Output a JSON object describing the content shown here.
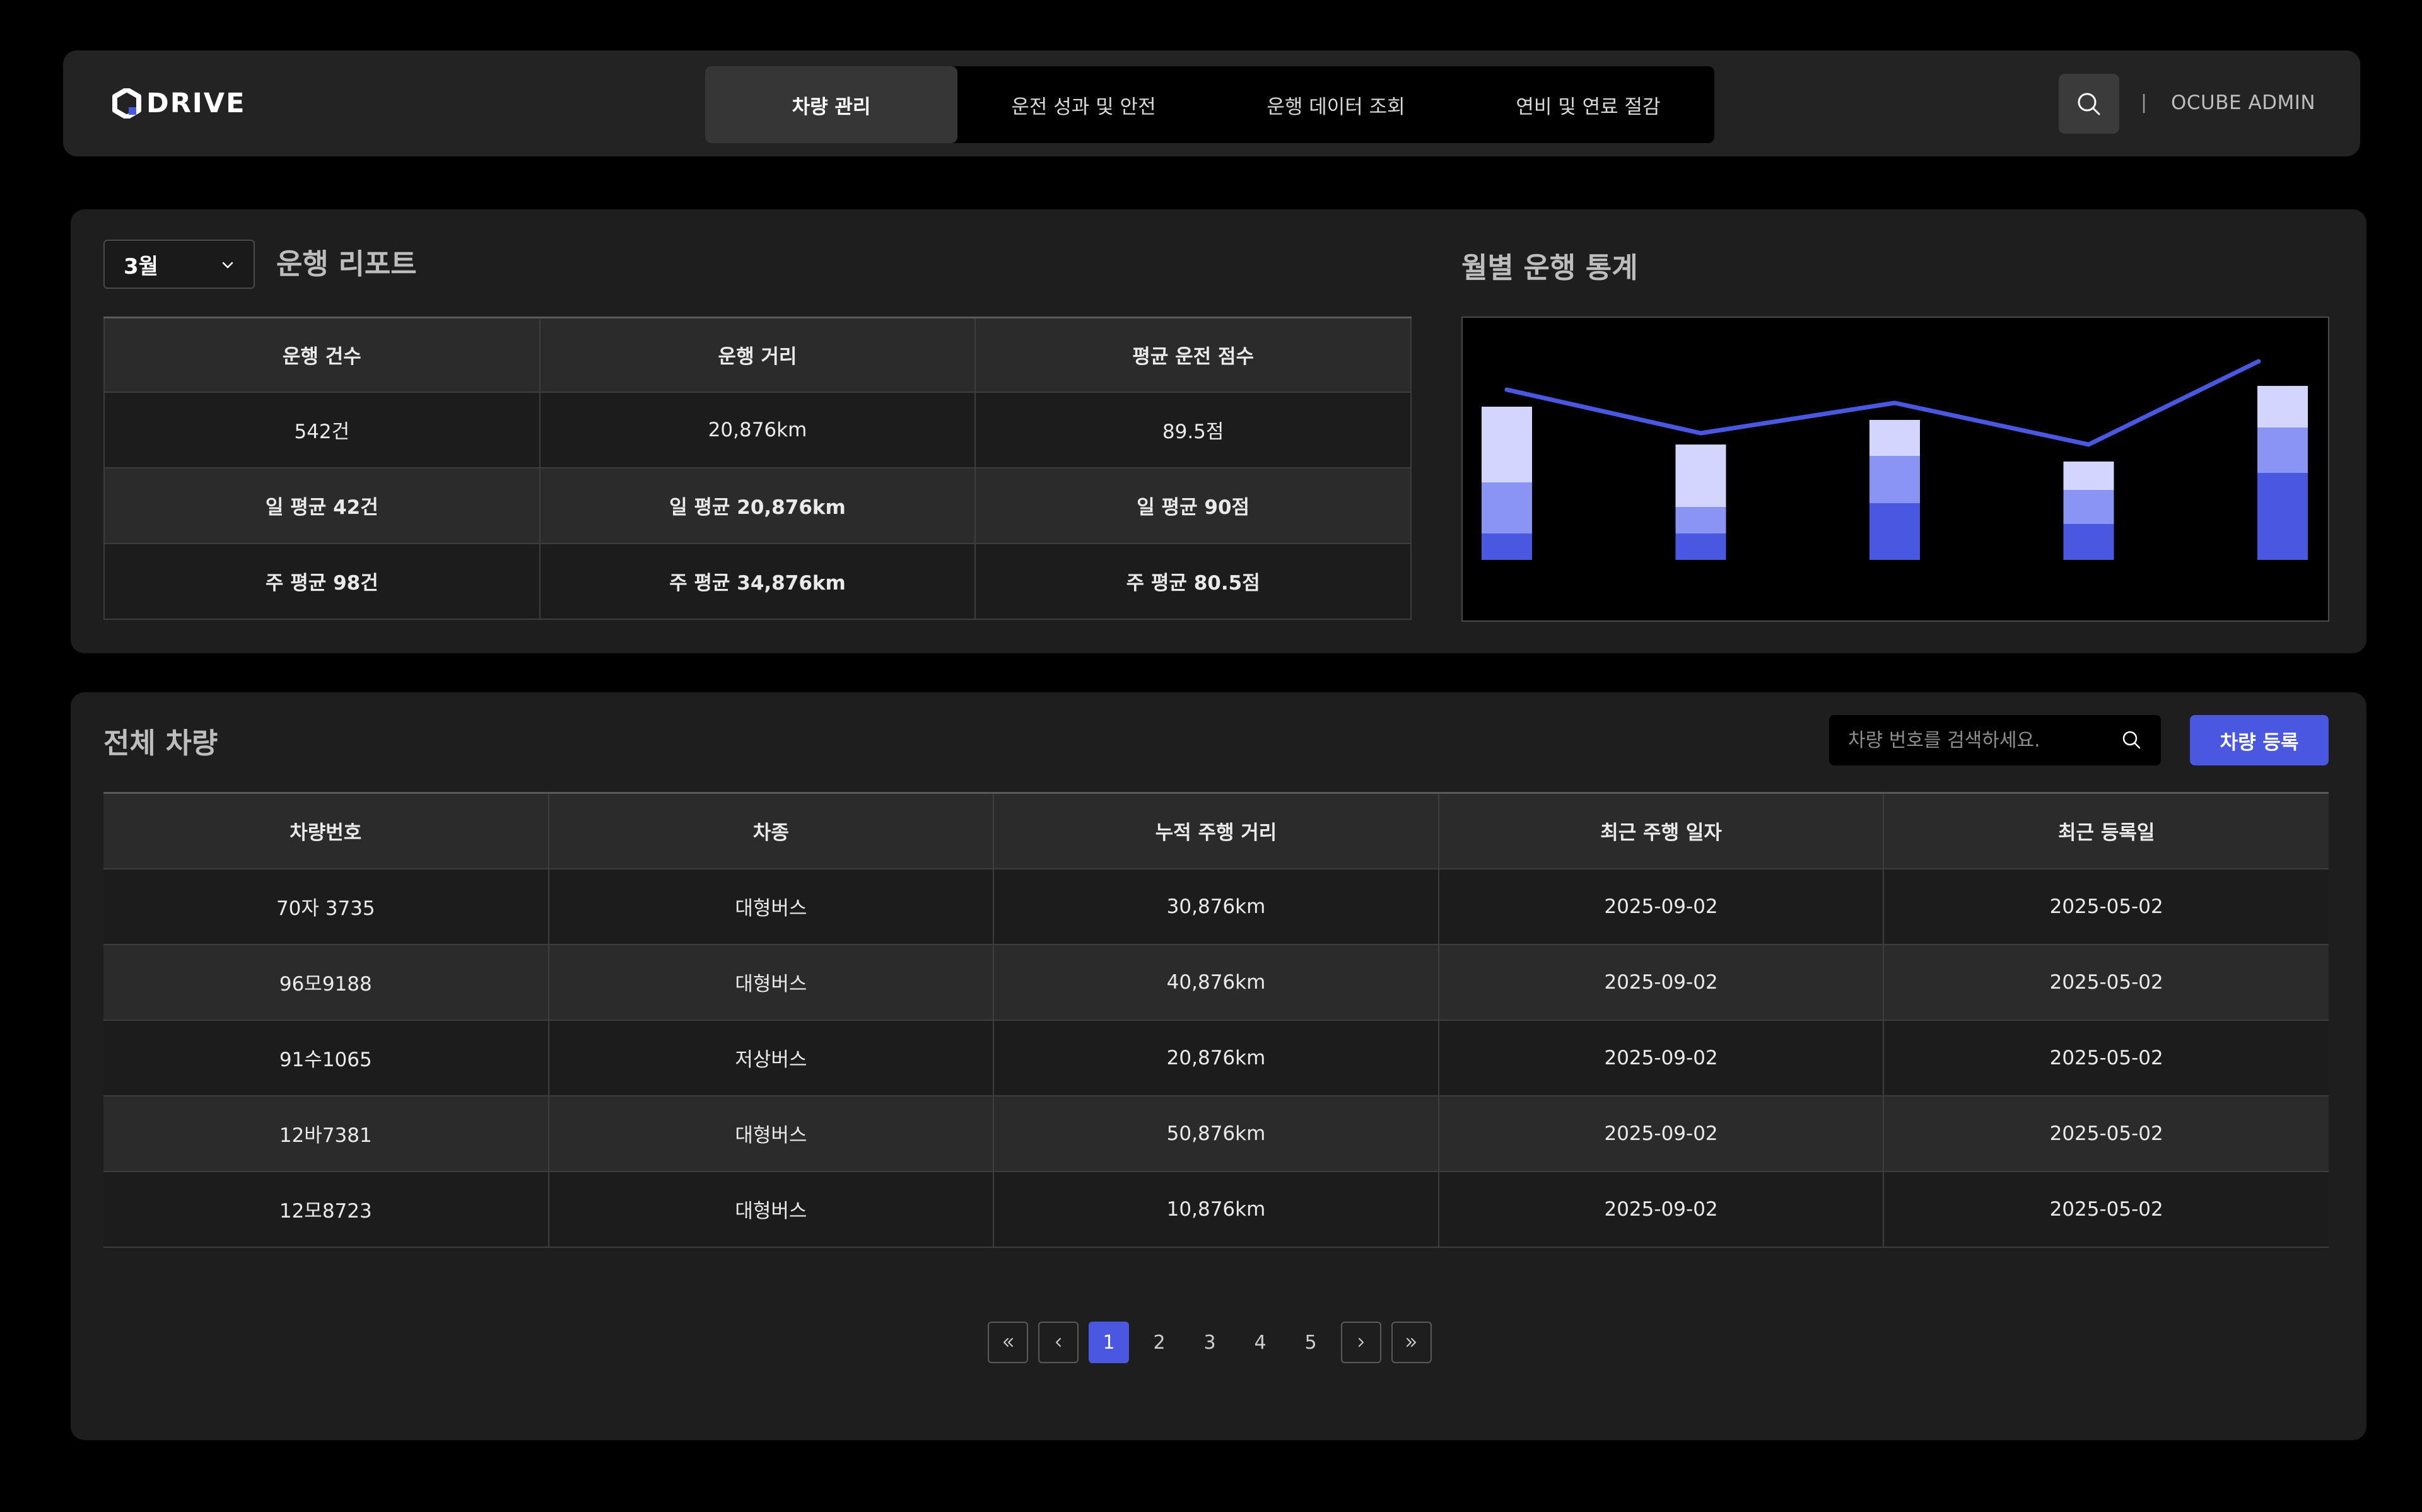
{
  "header": {
    "logo_text": "DRIVE",
    "nav_tabs": [
      {
        "label": "차량 관리",
        "active": true
      },
      {
        "label": "운전 성과 및 안전",
        "active": false
      },
      {
        "label": "운행 데이터 조회",
        "active": false
      },
      {
        "label": "연비 및 연료 절감",
        "active": false
      }
    ],
    "search_icon": "search-icon",
    "separator": "|",
    "admin_label": "OCUBE ADMIN"
  },
  "report": {
    "month_value": "3월",
    "title": "운행 리포트",
    "headers": [
      "운행 건수",
      "운행 거리",
      "평균 운전 점수"
    ],
    "rows": [
      [
        "542건",
        "20,876km",
        "89.5점"
      ],
      [
        "일 평균 42건",
        "일 평균 20,876km",
        "일 평균 90점"
      ],
      [
        "주 평균 98건",
        "주 평균 34,876km",
        "주 평균 80.5점"
      ]
    ]
  },
  "chart": {
    "title": "월별 운행 통계"
  },
  "chart_data": {
    "type": "bar",
    "stacked": true,
    "categories": [
      "",
      "",
      "",
      "",
      ""
    ],
    "series": [
      {
        "values": [
          14,
          14,
          30,
          19,
          46
        ],
        "color": "#4a57e0"
      },
      {
        "values": [
          27,
          14,
          25,
          18,
          24
        ],
        "color": "#8a95f3"
      },
      {
        "values": [
          40,
          33,
          19,
          15,
          22
        ],
        "color": "#d2d6ff"
      }
    ],
    "line": {
      "values": [
        90,
        67,
        83,
        61,
        105
      ],
      "color": "#4a57e0"
    },
    "ylim": [
      0,
      120
    ],
    "grid": false,
    "legend": "none"
  },
  "vehicles": {
    "title": "전체 차량",
    "search_placeholder": "차량 번호를 검색하세요.",
    "register_label": "차량 등록",
    "columns": [
      "차량번호",
      "차종",
      "누적 주행 거리",
      "최근 주행 일자",
      "최근 등록일"
    ],
    "rows": [
      [
        "70자 3735",
        "대형버스",
        "30,876km",
        "2025-09-02",
        "2025-05-02"
      ],
      [
        "96모9188",
        "대형버스",
        "40,876km",
        "2025-09-02",
        "2025-05-02"
      ],
      [
        "91수1065",
        "저상버스",
        "20,876km",
        "2025-09-02",
        "2025-05-02"
      ],
      [
        "12바7381",
        "대형버스",
        "50,876km",
        "2025-09-02",
        "2025-05-02"
      ],
      [
        "12모8723",
        "대형버스",
        "10,876km",
        "2025-09-02",
        "2025-05-02"
      ]
    ]
  },
  "pagination": {
    "pages": [
      "1",
      "2",
      "3",
      "4",
      "5"
    ],
    "current": "1",
    "first_icon": "double-chevron-left-icon",
    "prev_icon": "chevron-left-icon",
    "next_icon": "chevron-right-icon",
    "last_icon": "double-chevron-right-icon"
  }
}
